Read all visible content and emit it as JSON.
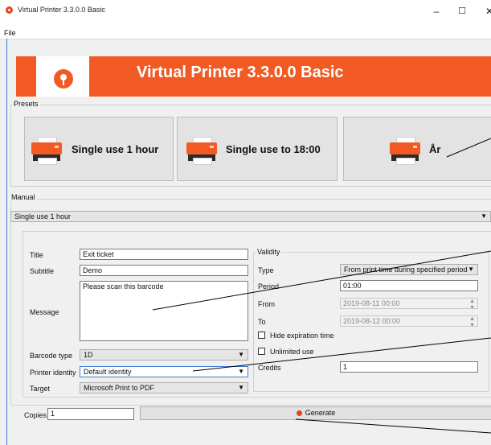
{
  "window": {
    "title": "Virtual Printer 3.3.0.0 Basic",
    "controls": {
      "minimize": "–",
      "maximize": "☐",
      "close": "✕"
    }
  },
  "menu": {
    "file": "File"
  },
  "banner": {
    "title": "Virtual Printer 3.3.0.0 Basic"
  },
  "presets": {
    "label": "Presets",
    "items": [
      {
        "label": "Single use 1 hour"
      },
      {
        "label": "Single use to 18:00"
      },
      {
        "label": "År"
      }
    ]
  },
  "manual": {
    "label": "Manual",
    "selected_preset": "Single use 1 hour"
  },
  "form": {
    "title_label": "Title",
    "title_value": "Exit ticket",
    "subtitle_label": "Subtitle",
    "subtitle_value": "Demo",
    "message_label": "Message",
    "message_value": "Please scan this barcode",
    "barcode_label": "Barcode type",
    "barcode_value": "1D",
    "identity_label": "Printer identity",
    "identity_value": "Default identity",
    "target_label": "Target",
    "target_value": "Microsoft Print to PDF"
  },
  "validity": {
    "label": "Validity",
    "type_label": "Type",
    "type_value": "From print time during specified period",
    "period_label": "Period",
    "period_value": "01:00",
    "from_label": "From",
    "from_value": "2019-08-11 00:00",
    "to_label": "To",
    "to_value": "2019-08-12 00:00",
    "hide_expiration_label": "Hide expiration time",
    "unlimited_label": "Unlimited use",
    "credits_label": "Credits",
    "credits_value": "1"
  },
  "footer": {
    "copies_label": "Copies",
    "copies_value": "1",
    "generate_label": "Generate"
  },
  "colors": {
    "accent": "#f15a24",
    "focus": "#3a7bd5",
    "tile": "#e3e3e3"
  }
}
